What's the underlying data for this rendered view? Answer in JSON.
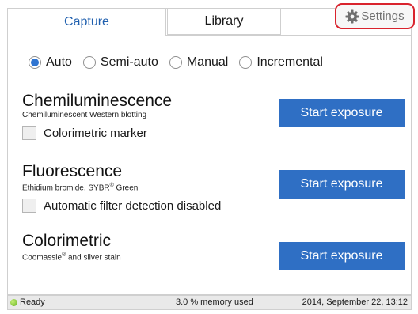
{
  "tabs": [
    {
      "label": "Capture",
      "active": true
    },
    {
      "label": "Library",
      "active": false
    }
  ],
  "settings": {
    "label": "Settings",
    "icon": "gear-icon"
  },
  "modes": [
    {
      "label": "Auto",
      "selected": true
    },
    {
      "label": "Semi-auto",
      "selected": false
    },
    {
      "label": "Manual",
      "selected": false
    },
    {
      "label": "Incremental",
      "selected": false
    }
  ],
  "sections": {
    "chemi": {
      "title": "Chemiluminescence",
      "subtitle": "Chemiluminescent Western blotting",
      "checkbox_label": "Colorimetric marker",
      "button_label": "Start exposure"
    },
    "fluor": {
      "title": "Fluorescence",
      "subtitle_a": "Ethidium bromide, SYBR",
      "subtitle_b": " Green",
      "checkbox_label": "Automatic filter detection disabled",
      "button_label": "Start exposure"
    },
    "color": {
      "title": "Colorimetric",
      "subtitle_a": "Coomassie",
      "subtitle_b": " and silver stain",
      "button_label": "Start exposure"
    }
  },
  "trademark": "®",
  "status": {
    "state": "Ready",
    "memory": "3.0 % memory used",
    "datetime": "2014, September 22, 13:12"
  },
  "colors": {
    "accent": "#2f6fc4",
    "settings_highlight": "#d9232d",
    "status_ok": "#5fae1a"
  }
}
